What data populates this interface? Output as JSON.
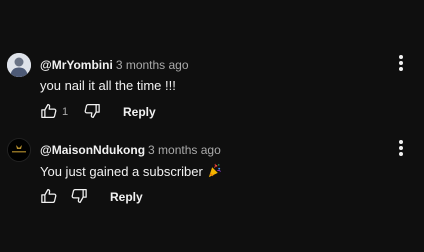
{
  "comments": [
    {
      "author": "@MrYombini",
      "time": "3 months ago",
      "text": "you nail it all the time !!!",
      "like_count": "1",
      "reply_label": "Reply"
    },
    {
      "author": "@MaisonNdukong",
      "time": "3 months ago",
      "text": "You just gained a subscriber",
      "reply_label": "Reply"
    }
  ],
  "icons": {
    "like": "thumbs-up-icon",
    "dislike": "thumbs-down-icon",
    "menu": "more-vert-icon",
    "emoji": "party-popper"
  },
  "colors": {
    "background": "#0f0f0f",
    "primary_text": "#f1f1f1",
    "secondary_text": "#aaaaaa"
  }
}
